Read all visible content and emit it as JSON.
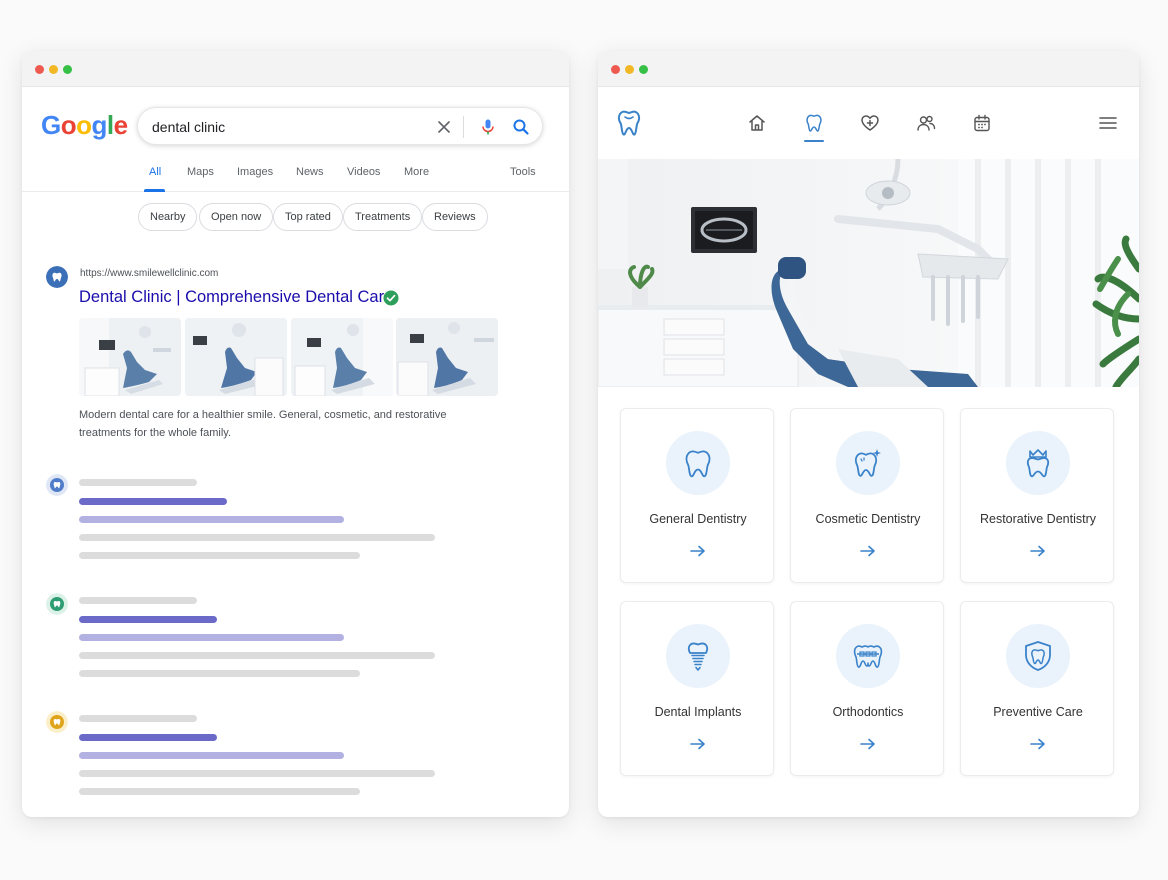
{
  "search": {
    "logo": [
      "G",
      "o",
      "o",
      "g",
      "l",
      "e"
    ],
    "logo_colors": [
      "#4285f4",
      "#ea4335",
      "#fbbc05",
      "#4285f4",
      "#34a853",
      "#ea4335"
    ],
    "query": "dental clinic",
    "tabs": [
      {
        "label": "All"
      },
      {
        "label": "Maps"
      },
      {
        "label": "Images"
      },
      {
        "label": "News"
      },
      {
        "label": "Videos"
      },
      {
        "label": "More"
      }
    ],
    "tools_label": "Tools",
    "chips": [
      "Nearby",
      "Open now",
      "Top rated",
      "Treatments",
      "Reviews"
    ],
    "result": {
      "url": "https://www.smilewellclinic.com",
      "title": "Dental Clinic | Comprehensive Dental Care",
      "snippet_line1": "Modern dental care for a healthier smile. General, cosmetic, and restorative",
      "snippet_line2": "treatments for the whole family."
    },
    "placeholder_result_icon_colors": [
      "#4f7dc9",
      "#2f9d73",
      "#e0a41b"
    ]
  },
  "site": {
    "accent": "#3a82c9",
    "services": [
      {
        "label": "General Dentistry",
        "icon": "tooth-icon"
      },
      {
        "label": "Cosmetic Dentistry",
        "icon": "sparkle-tooth-icon"
      },
      {
        "label": "Restorative Dentistry",
        "icon": "crown-tooth-icon"
      },
      {
        "label": "Dental Implants",
        "icon": "implant-icon"
      },
      {
        "label": "Orthodontics",
        "icon": "braces-icon"
      },
      {
        "label": "Preventive Care",
        "icon": "shield-tooth-icon"
      }
    ]
  }
}
